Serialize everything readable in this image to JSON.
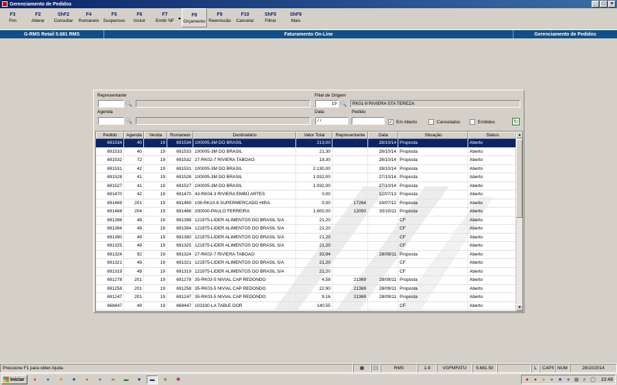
{
  "window": {
    "title": "Gerenciamento de Pedidos",
    "controls": [
      "_",
      "□",
      "×"
    ]
  },
  "toolbar": {
    "buttons": [
      {
        "key": "F3",
        "label": "Fim"
      },
      {
        "key": "F2",
        "label": "Alterar"
      },
      {
        "key": "ShF2",
        "label": "Consultar"
      },
      {
        "key": "F4",
        "label": "Romaneio"
      },
      {
        "key": "F5",
        "label": "Suspensos"
      },
      {
        "key": "F6",
        "label": "Incluir"
      },
      {
        "key": "F7",
        "label": "Emitir NF"
      },
      {
        "key": "F8",
        "label": "Orçamento"
      },
      {
        "key": "F9",
        "label": "Reemissão"
      },
      {
        "key": "F10",
        "label": "Cancelar"
      },
      {
        "key": "ShF5",
        "label": "Filtrar"
      },
      {
        "key": "ShF9",
        "label": "Mais"
      }
    ]
  },
  "infobar": {
    "left": "G-RMS Retail 5.681 RMS",
    "middle": "Faturamento On-Line",
    "right": "Gerenciamento de Pedidos"
  },
  "filters": {
    "representante_label": "Representante",
    "representante_value": "",
    "filial_label": "Filial de Origem",
    "filial_code": "19",
    "filial_name": "RK01-9 RIVIERA STA TEREZA",
    "agenda_label": "Agenda",
    "agenda_value": "",
    "data_label": "Data",
    "data_value": "/ /",
    "pedido_label": "Pedido",
    "pedido_value": "",
    "em_aberto_label": "Em Aberto",
    "cancelados_label": "Cancelados",
    "emitidos_label": "Emitidos",
    "em_aberto_checked": "✓"
  },
  "grid": {
    "headers": [
      "Pedido",
      "Agenda",
      "Venda",
      "Romaneio",
      "Destinatário",
      "Valor Total",
      "Representante",
      "Data",
      "Situação",
      "Status"
    ],
    "rows": [
      [
        "691534",
        "40",
        "19",
        "691534",
        "100005-3M DO BRASIL",
        "213,00",
        "",
        "28/10/14",
        "Proposta",
        "Aberto"
      ],
      [
        "691533",
        "40",
        "19",
        "691533",
        "100005-3M DO BRASIL",
        "21,30",
        "",
        "28/10/14",
        "Proposta",
        "Aberto"
      ],
      [
        "691532",
        "72",
        "19",
        "691532",
        "27-RK02-7 RIVIERA TABOAO",
        "19,30",
        "",
        "28/10/14",
        "Proposta",
        "Aberto"
      ],
      [
        "691531",
        "42",
        "19",
        "691531",
        "100005-3M DO BRASIL",
        "2.130,00",
        "",
        "28/10/14",
        "Proposta",
        "Aberto"
      ],
      [
        "691528",
        "41",
        "19",
        "691528",
        "100005-3M DO BRASIL",
        "1.932,00",
        "",
        "27/10/14",
        "Proposta",
        "Aberto"
      ],
      [
        "691527",
        "41",
        "19",
        "691527",
        "100005-3M DO BRASIL",
        "1.932,00",
        "",
        "27/10/14",
        "Proposta",
        "Aberto"
      ],
      [
        "691470",
        "42",
        "19",
        "691470",
        "43-RK04-3 RIVIERA EMBÚ ARTES",
        "0,00",
        "",
        "12/07/13",
        "Proposta",
        "Aberto"
      ],
      [
        "691469",
        "201",
        "19",
        "691469",
        "108-RK10-8 SUPERMERCADO HIRA",
        "0,00",
        "17264",
        "19/07/12",
        "Proposta",
        "Aberto"
      ],
      [
        "691468",
        "204",
        "19",
        "691468",
        "200000-PAULO FERREIRA",
        "1.600,00",
        "12050",
        "30/10/11",
        "Proposta",
        "Aberto"
      ],
      [
        "691398",
        "49",
        "19",
        "691398",
        "121975-LIDER ALIMENTOS DO BRASIL S/A",
        "21,20",
        "",
        "",
        "CF",
        "Aberto"
      ],
      [
        "691394",
        "49",
        "19",
        "691394",
        "121975-LIDER ALIMENTOS DO BRASIL S/A",
        "21,20",
        "",
        "",
        "CF",
        "Aberto"
      ],
      [
        "691390",
        "49",
        "19",
        "691390",
        "121975-LIDER ALIMENTOS DO BRASIL S/A",
        "21,20",
        "",
        "",
        "CF",
        "Aberto"
      ],
      [
        "691325",
        "49",
        "19",
        "691325",
        "121975-LIDER ALIMENTOS DO BRASIL S/A",
        "21,20",
        "",
        "",
        "CF",
        "Aberto"
      ],
      [
        "691324",
        "92",
        "19",
        "691324",
        "27-RK02-7 RIVIERA TABOAO",
        "33,94",
        "",
        "28/09/11",
        "Proposta",
        "Aberto"
      ],
      [
        "691321",
        "49",
        "19",
        "691321",
        "121975-LIDER ALIMENTOS DO BRASIL S/A",
        "21,20",
        "",
        "",
        "CF",
        "Aberto"
      ],
      [
        "691319",
        "49",
        "19",
        "691319",
        "121975-LIDER ALIMENTOS DO BRASIL S/A",
        "21,20",
        "",
        "",
        "CF",
        "Aberto"
      ],
      [
        "691278",
        "201",
        "19",
        "691278",
        "35-RK03-5 NIVIAL CAP REDONDO",
        "4,58",
        "21369",
        "28/09/11",
        "Proposta",
        "Aberto"
      ],
      [
        "691258",
        "201",
        "19",
        "691258",
        "35-RK03-5 NIVIAL CAP REDONDO",
        "22,90",
        "21369",
        "28/09/11",
        "Proposta",
        "Aberto"
      ],
      [
        "691247",
        "201",
        "19",
        "691247",
        "35-RK03-5 NIVIAL CAP REDONDO",
        "9,16",
        "21369",
        "28/09/11",
        "Proposta",
        "Aberto"
      ],
      [
        "668447",
        "49",
        "19",
        "668447",
        "103330-LA TABLE DOR",
        "140,55",
        "",
        "",
        "CF",
        "Aberto"
      ]
    ]
  },
  "statusbar": {
    "help": "Pressione F1 para obter Ajuda",
    "system": "RMS",
    "range": "1-9",
    "program": "VGFMFATU",
    "version": "5.681.50",
    "l": "L",
    "caps": "CAPS",
    "num": "NUM",
    "date": "28/10/2014"
  },
  "taskbar": {
    "start_label": "Iniciar",
    "clock": "10:48"
  }
}
